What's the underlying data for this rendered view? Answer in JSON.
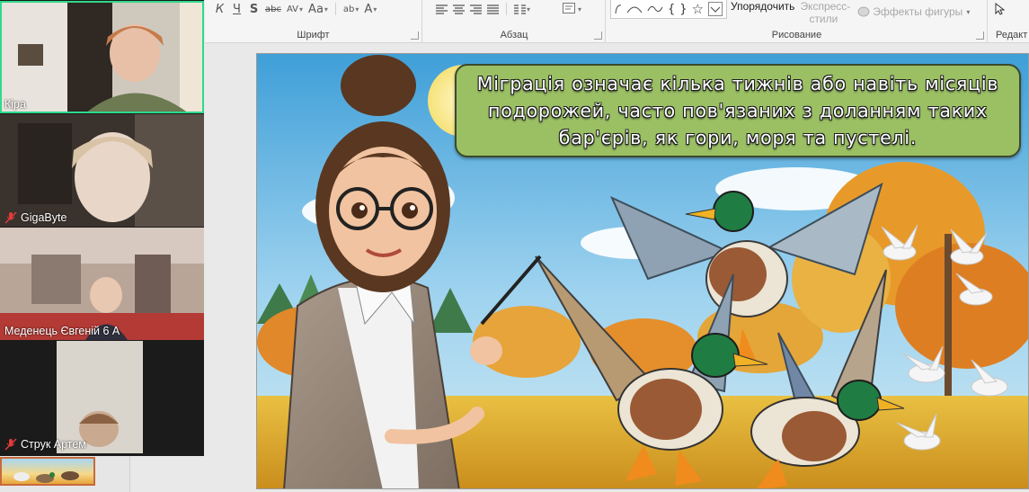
{
  "ribbon": {
    "font_buttons": [
      "К",
      "Ч",
      "S",
      "abc",
      "AV",
      "Aa",
      "ab",
      "A"
    ],
    "groups": {
      "font": "Шрифт",
      "paragraph": "Абзац",
      "drawing": "Рисование",
      "editing": "Редакт"
    },
    "arrange_label": "Упорядочить",
    "quick_styles_line1": "Экспресс-",
    "quick_styles_line2": "стили",
    "shape_effects_label": "Эффекты фигуры"
  },
  "participants": [
    {
      "name": "Кіра",
      "muted": false,
      "active": true
    },
    {
      "name": "GigaByte",
      "muted": true,
      "active": false
    },
    {
      "name": "Меденець Євгеній 6 А",
      "muted": false,
      "active": false
    },
    {
      "name": "Струк Артем",
      "muted": true,
      "active": false
    }
  ],
  "slide": {
    "callout_text": "Міграція означає кілька тижнів або навіть місяців подорожей, часто пов'язаних з доланням таких бар'єрів, як гори, моря та пустелі."
  },
  "colors": {
    "active_speaker": "#2fd98b",
    "callout_fill": "#9bc064",
    "muted_icon": "#e03b3b"
  }
}
